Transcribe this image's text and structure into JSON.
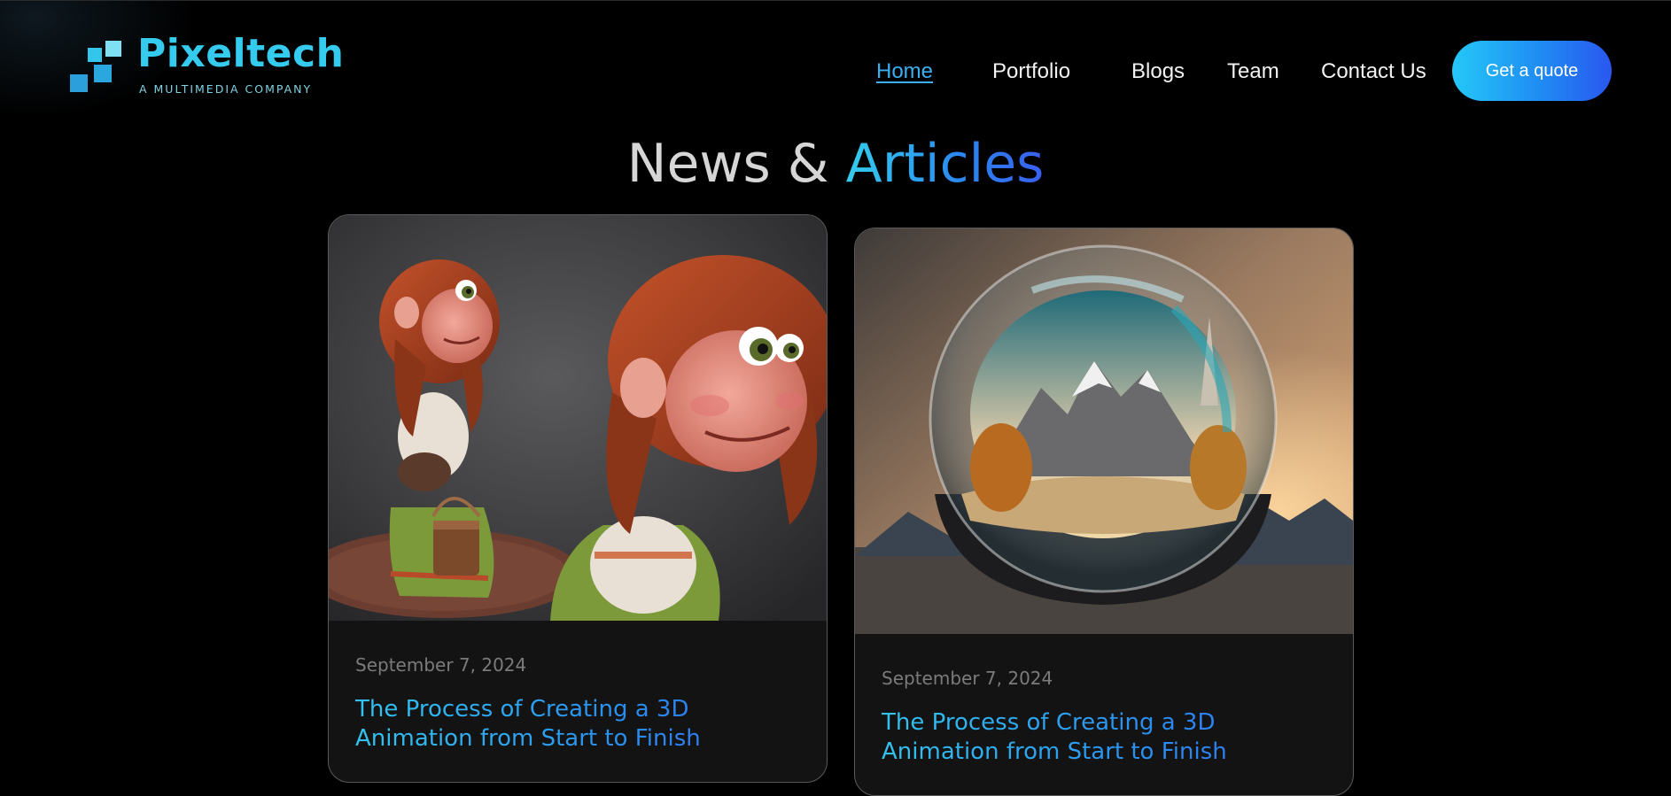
{
  "brand": {
    "name": "Pixeltech",
    "tagline": "A MULTIMEDIA COMPANY",
    "logo_icon": "pixel-blocks-logo"
  },
  "nav": {
    "items": [
      {
        "label": "Home",
        "active": true
      },
      {
        "label": "Portfolio",
        "active": false
      },
      {
        "label": "Blogs",
        "active": false
      },
      {
        "label": "Team",
        "active": false
      },
      {
        "label": "Contact Us",
        "active": false
      }
    ],
    "cta_label": "Get a quote"
  },
  "section": {
    "title_part1": "News & ",
    "title_part2": "Articles"
  },
  "articles": [
    {
      "image_subject": "3D animated red-haired girl character holding a wooden bucket",
      "date": "September 7, 2024",
      "title": "The Process of Creating a 3D Animation from Start to Finish"
    },
    {
      "image_subject": "Glass sphere containing snowy mountain landscape at sunset",
      "date": "September 7, 2024",
      "title": "The Process of Creating a 3D Animation from Start to Finish"
    }
  ],
  "colors": {
    "background": "#000000",
    "accent_cyan": "#35cbee",
    "accent_blue": "#2a57f0",
    "nav_active": "#3ab0f0",
    "card_bg": "#131313",
    "card_border": "#5a5a5a",
    "date_gray": "#7b7b7b"
  }
}
